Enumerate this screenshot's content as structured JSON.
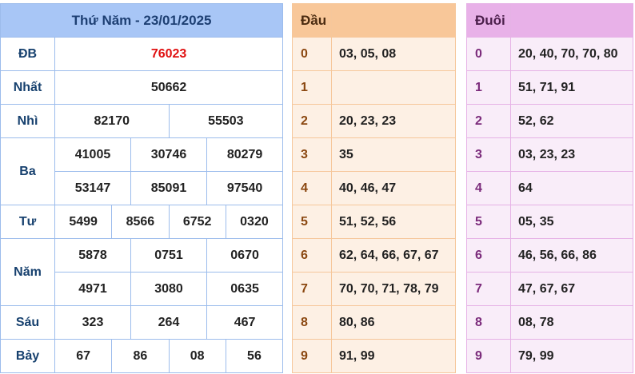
{
  "results": {
    "title": "Thứ Năm - 23/01/2025",
    "prizes": {
      "db": {
        "label": "ĐB",
        "values": [
          "76023"
        ]
      },
      "nhat": {
        "label": "Nhất",
        "values": [
          "50662"
        ]
      },
      "nhi": {
        "label": "Nhì",
        "values": [
          "82170",
          "55503"
        ]
      },
      "ba": {
        "label": "Ba",
        "values": [
          "41005",
          "30746",
          "80279",
          "53147",
          "85091",
          "97540"
        ]
      },
      "tu": {
        "label": "Tư",
        "values": [
          "5499",
          "8566",
          "6752",
          "0320"
        ]
      },
      "nam": {
        "label": "Năm",
        "values": [
          "5878",
          "0751",
          "0670",
          "4971",
          "3080",
          "0635"
        ]
      },
      "sau": {
        "label": "Sáu",
        "values": [
          "323",
          "264",
          "467"
        ]
      },
      "bay": {
        "label": "Bảy",
        "values": [
          "67",
          "86",
          "08",
          "56"
        ]
      }
    }
  },
  "head": {
    "title": "Đầu",
    "rows": [
      {
        "k": "0",
        "v": "03, 05, 08"
      },
      {
        "k": "1",
        "v": ""
      },
      {
        "k": "2",
        "v": "20, 23, 23"
      },
      {
        "k": "3",
        "v": "35"
      },
      {
        "k": "4",
        "v": "40, 46, 47"
      },
      {
        "k": "5",
        "v": "51, 52, 56"
      },
      {
        "k": "6",
        "v": "62, 64, 66, 67, 67"
      },
      {
        "k": "7",
        "v": "70, 70, 71, 78, 79"
      },
      {
        "k": "8",
        "v": "80, 86"
      },
      {
        "k": "9",
        "v": "91, 99"
      }
    ]
  },
  "tail": {
    "title": "Đuôi",
    "rows": [
      {
        "k": "0",
        "v": "20, 40, 70, 70, 80"
      },
      {
        "k": "1",
        "v": "51, 71, 91"
      },
      {
        "k": "2",
        "v": "52, 62"
      },
      {
        "k": "3",
        "v": "03, 23, 23"
      },
      {
        "k": "4",
        "v": "64"
      },
      {
        "k": "5",
        "v": "05, 35"
      },
      {
        "k": "6",
        "v": "46, 56, 66, 86"
      },
      {
        "k": "7",
        "v": "47, 67, 67"
      },
      {
        "k": "8",
        "v": "08, 78"
      },
      {
        "k": "9",
        "v": "79, 99"
      }
    ]
  }
}
